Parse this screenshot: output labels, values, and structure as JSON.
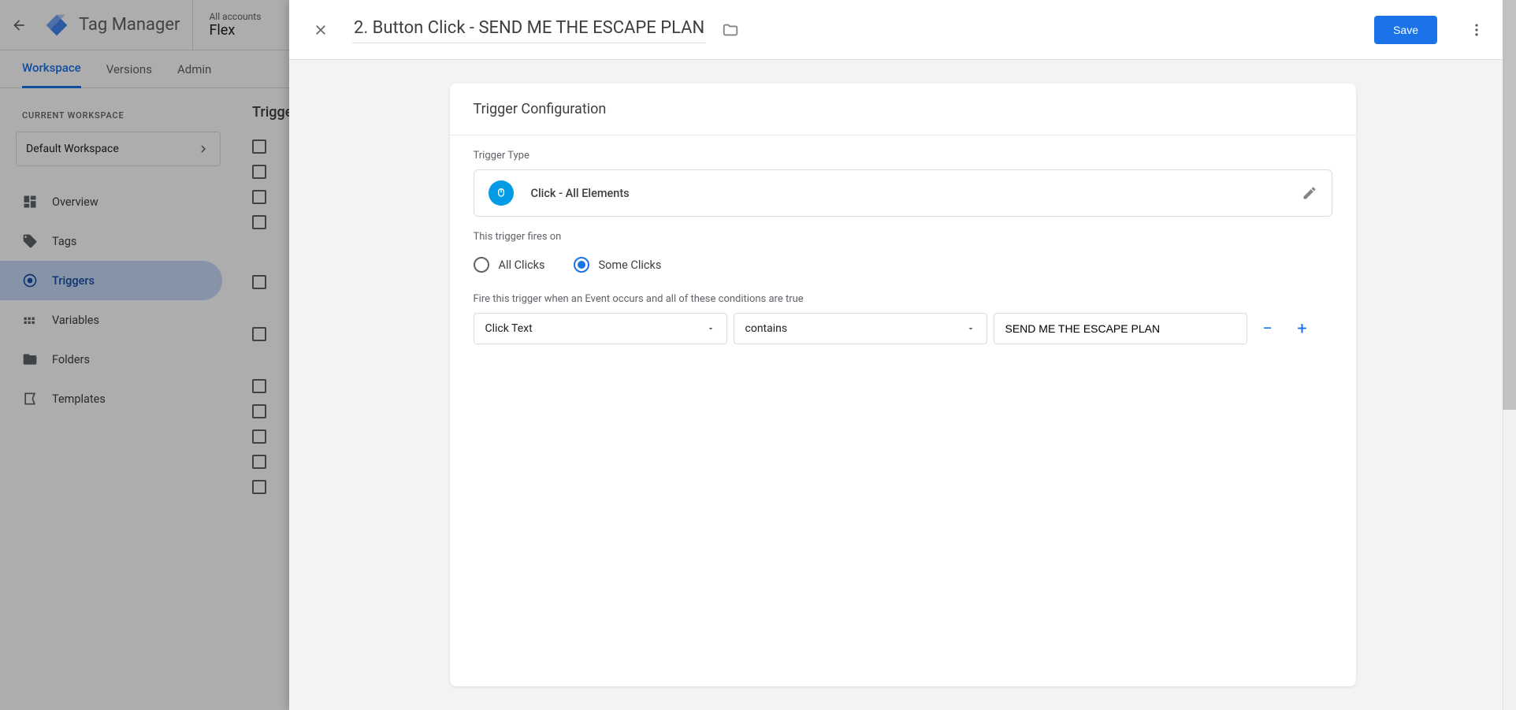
{
  "app": {
    "title": "Tag Manager",
    "account_label": "All accounts",
    "container": "Flex"
  },
  "tabs": {
    "workspace": "Workspace",
    "versions": "Versions",
    "admin": "Admin"
  },
  "workspace": {
    "label": "CURRENT WORKSPACE",
    "selected": "Default Workspace"
  },
  "nav": {
    "overview": "Overview",
    "tags": "Tags",
    "triggers": "Triggers",
    "variables": "Variables",
    "folders": "Folders",
    "templates": "Templates"
  },
  "list_header": "Triggers",
  "modal": {
    "title": "2. Button Click - SEND ME THE ESCAPE PLAN",
    "save": "Save",
    "card_title": "Trigger Configuration",
    "type_label": "Trigger Type",
    "type_value": "Click - All Elements",
    "fires_label": "This trigger fires on",
    "radio_all": "All Clicks",
    "radio_some": "Some Clicks",
    "cond_label": "Fire this trigger when an Event occurs and all of these conditions are true",
    "cond_variable": "Click Text",
    "cond_operator": "contains",
    "cond_value": "SEND ME THE ESCAPE PLAN"
  }
}
